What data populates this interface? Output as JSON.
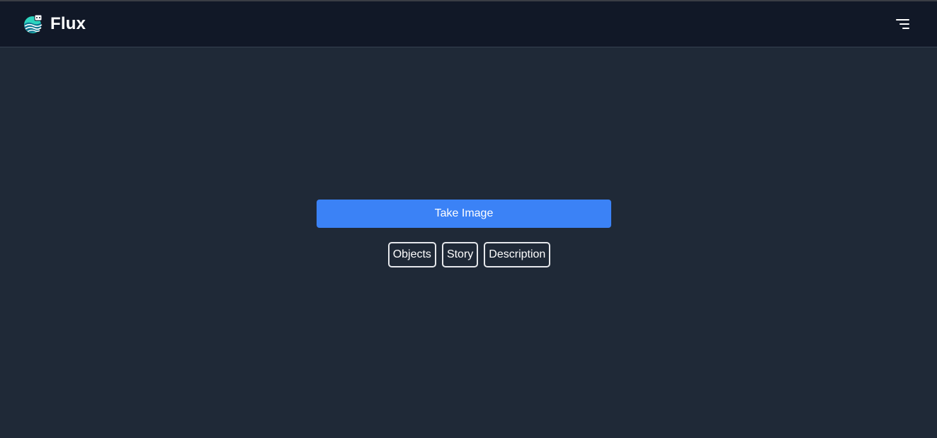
{
  "app": {
    "name": "Flux",
    "logo_icon": "flux-wave-logo-icon",
    "menu_icon": "hamburger-menu-icon"
  },
  "main": {
    "primary_action_label": "Take Image",
    "modes": [
      {
        "id": "objects",
        "label": "Objects"
      },
      {
        "id": "story",
        "label": "Story"
      },
      {
        "id": "description",
        "label": "Description"
      }
    ]
  },
  "colors": {
    "page_background": "#1f2937",
    "navbar_background": "#111827",
    "primary_button": "#3b82f6",
    "outline_button_border": "#e5e7eb",
    "text": "#ffffff"
  }
}
